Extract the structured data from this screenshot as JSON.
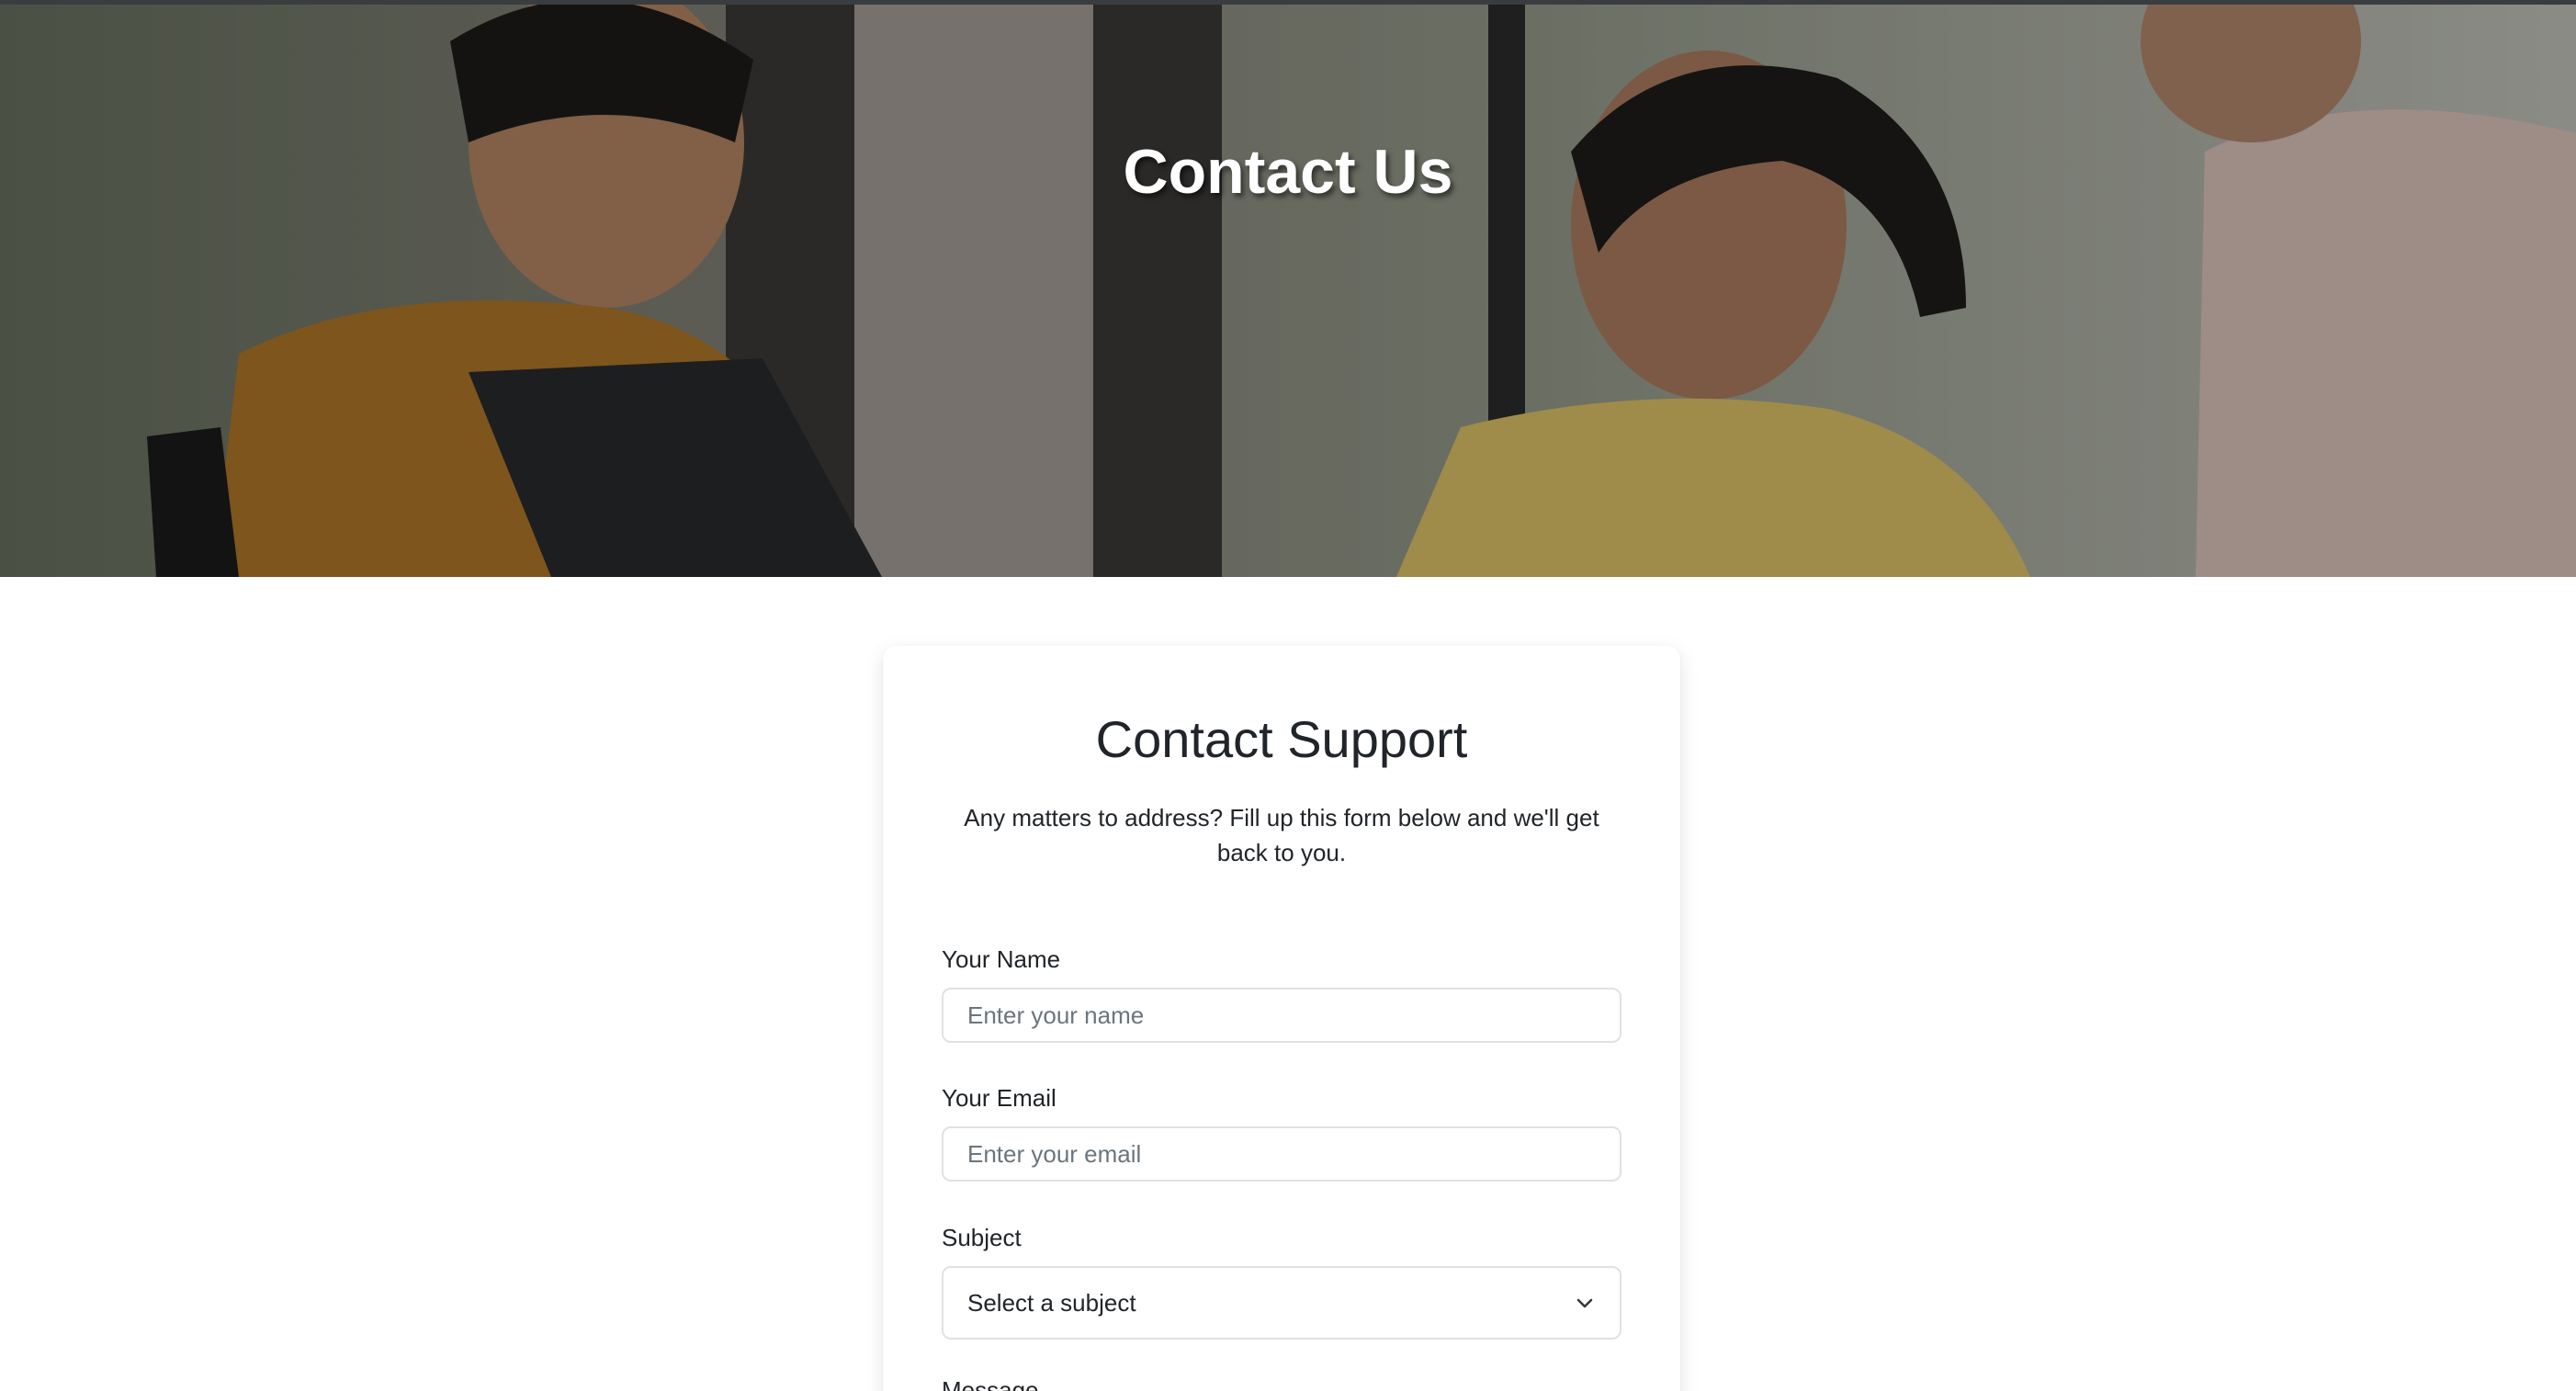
{
  "hero": {
    "title": "Contact Us"
  },
  "form": {
    "title": "Contact Support",
    "subtitle": "Any matters to address? Fill up this form below and we'll get back to you.",
    "name": {
      "label": "Your Name",
      "placeholder": "Enter your name",
      "value": ""
    },
    "email": {
      "label": "Your Email",
      "placeholder": "Enter your email",
      "value": ""
    },
    "subject": {
      "label": "Subject",
      "selected": "Select a subject",
      "icon": "chevron-down-icon"
    },
    "message": {
      "label": "Message"
    }
  },
  "colors": {
    "text": "#212529",
    "placeholder": "#6c757d",
    "border": "#dee2e6",
    "hero_text": "#ffffff"
  }
}
